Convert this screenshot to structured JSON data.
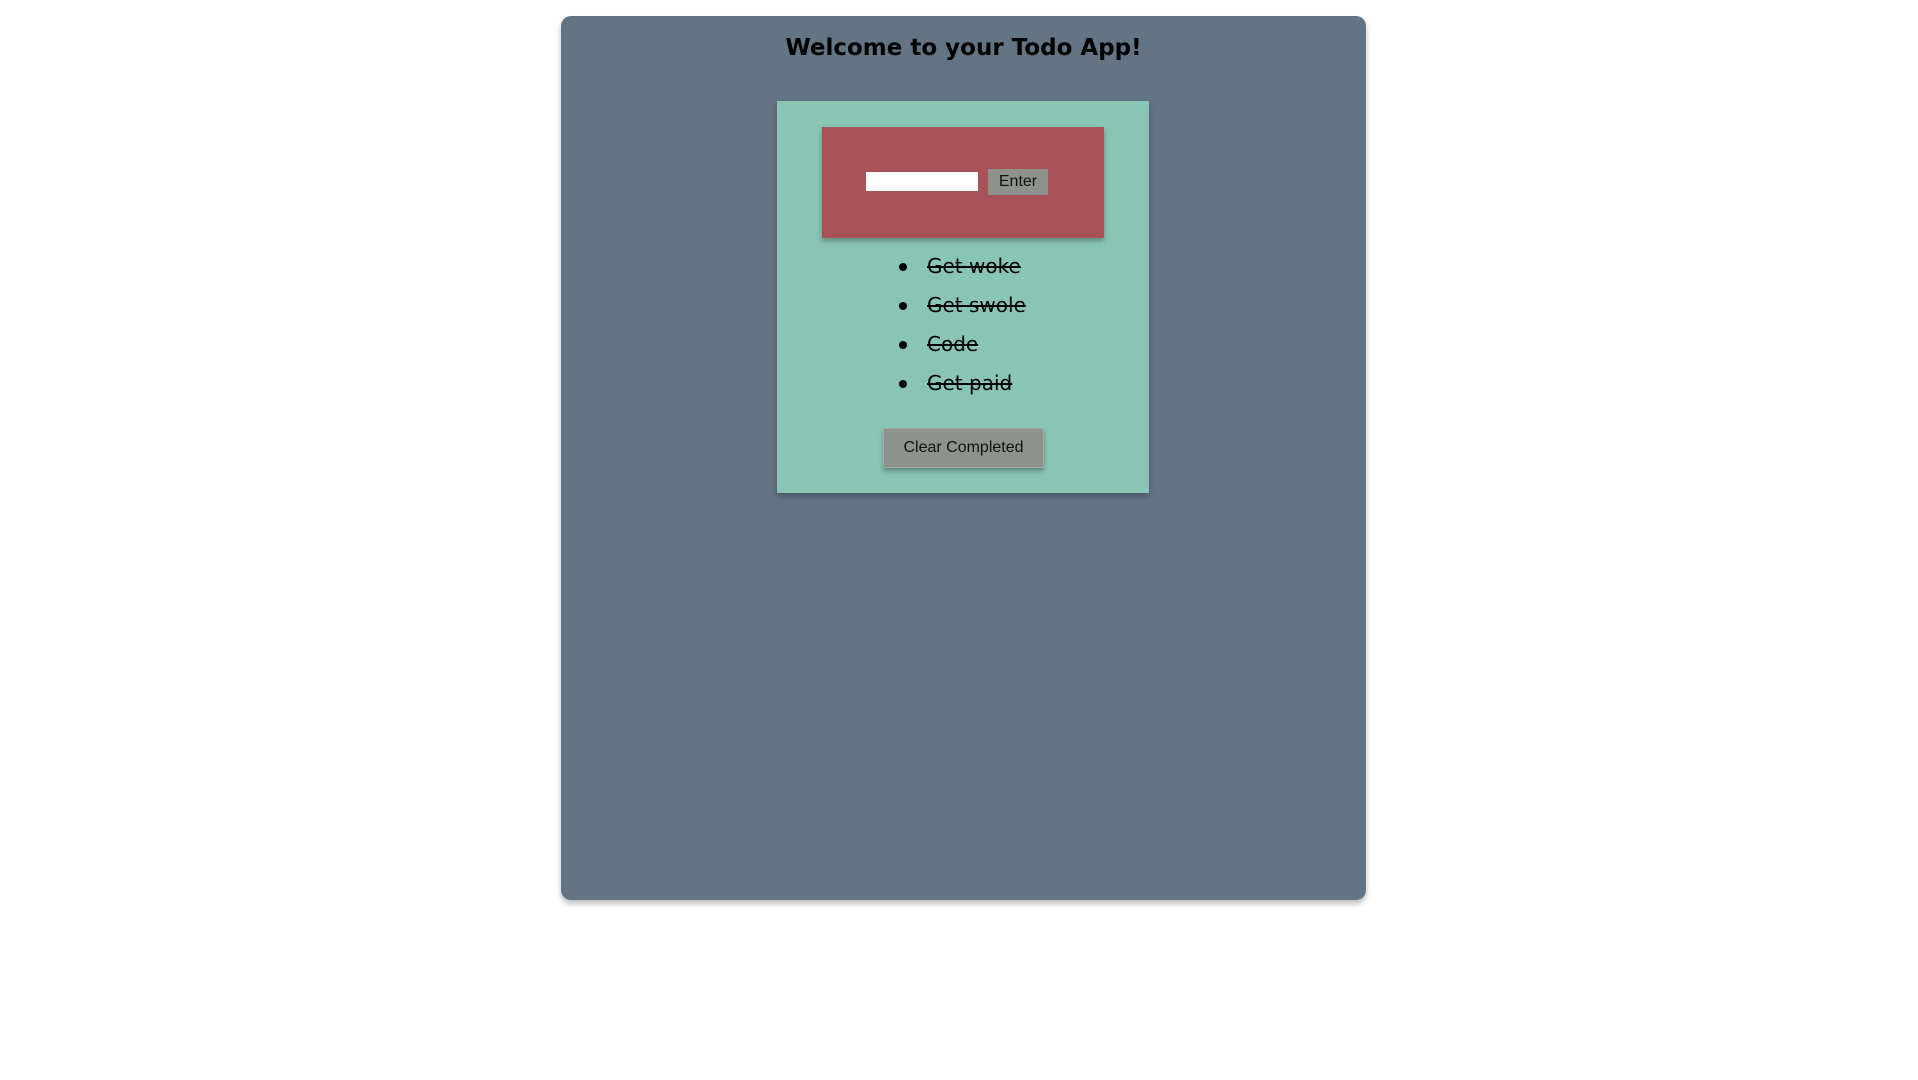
{
  "app": {
    "title": "Welcome to your Todo App!"
  },
  "form": {
    "input_value": "",
    "input_placeholder": "",
    "enter_label": "Enter"
  },
  "todos": [
    {
      "text": "Get woke",
      "completed": true
    },
    {
      "text": "Get swole",
      "completed": true
    },
    {
      "text": "Code",
      "completed": true
    },
    {
      "text": "Get paid",
      "completed": true
    }
  ],
  "actions": {
    "clear_completed_label": "Clear Completed"
  },
  "colors": {
    "page_background": "#ffffff",
    "app_background": "#637485",
    "card_background": "#89c5b5",
    "input_panel_background": "#a85257",
    "button_background": "#8e928c"
  }
}
